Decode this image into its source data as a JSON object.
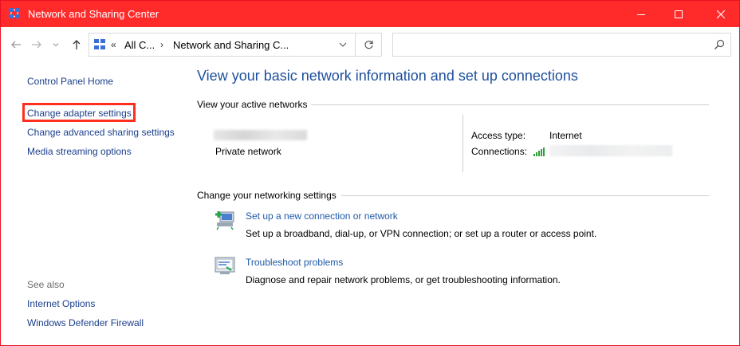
{
  "window": {
    "title": "Network and Sharing Center",
    "accent_color": "#ff2b2b",
    "controls": [
      "minimize-icon",
      "maximize-icon",
      "close-icon"
    ]
  },
  "navbar": {
    "back_icon": "back-arrow-icon",
    "forward_icon": "forward-arrow-icon",
    "recent_icon": "chevron-down-icon",
    "up_icon": "up-arrow-icon",
    "overflow": "«",
    "breadcrumbs": [
      "All C...",
      "Network and Sharing C..."
    ],
    "refresh_icon": "refresh-icon",
    "search": {
      "value": "",
      "placeholder": "",
      "icon": "search-icon"
    }
  },
  "sidebar": {
    "home": "Control Panel Home",
    "links": [
      "Change adapter settings",
      "Change advanced sharing settings",
      "Media streaming options"
    ],
    "highlighted_index": 0,
    "see_also_heading": "See also",
    "see_also": [
      "Internet Options",
      "Windows Defender Firewall"
    ]
  },
  "main": {
    "title": "View your basic network information and set up connections",
    "active_networks_heading": "View your active networks",
    "network_type": "Private network",
    "access_type_label": "Access type:",
    "access_type_value": "Internet",
    "connections_label": "Connections:",
    "settings_heading": "Change your networking settings",
    "tasks": [
      {
        "link": "Set up a new connection or network",
        "desc": "Set up a broadband, dial-up, or VPN connection; or set up a router or access point.",
        "icon": "new-connection-icon"
      },
      {
        "link": "Troubleshoot problems",
        "desc": "Diagnose and repair network problems, or get troubleshooting information.",
        "icon": "troubleshoot-icon"
      }
    ]
  }
}
